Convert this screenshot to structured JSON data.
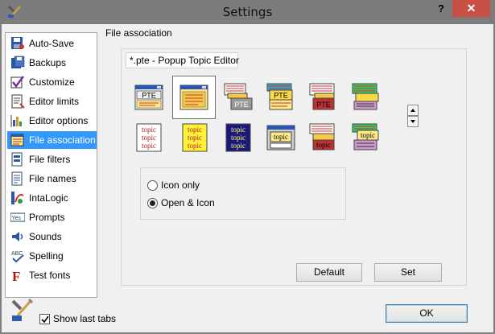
{
  "window": {
    "title": "Settings",
    "help_label": "?",
    "close_label": "✕"
  },
  "sidebar": {
    "items": [
      {
        "label": "Auto-Save",
        "icon": "auto-save-icon"
      },
      {
        "label": "Backups",
        "icon": "backups-icon"
      },
      {
        "label": "Customize",
        "icon": "customize-icon"
      },
      {
        "label": "Editor limits",
        "icon": "editor-limits-icon"
      },
      {
        "label": "Editor options",
        "icon": "editor-options-icon"
      },
      {
        "label": "File association",
        "icon": "file-association-icon",
        "selected": true
      },
      {
        "label": "File filters",
        "icon": "file-filters-icon"
      },
      {
        "label": "File names",
        "icon": "file-names-icon"
      },
      {
        "label": "IntaLogic",
        "icon": "intalogic-icon"
      },
      {
        "label": "Prompts",
        "icon": "prompts-icon"
      },
      {
        "label": "Sounds",
        "icon": "sounds-icon"
      },
      {
        "label": "Spelling",
        "icon": "spelling-icon"
      },
      {
        "label": "Test fonts",
        "icon": "test-fonts-icon"
      }
    ]
  },
  "panel": {
    "group_title": "File association",
    "association_text": "*.pte - Popup Topic Editor",
    "icon_labels": {
      "pte": "PTE",
      "topic": "topic"
    },
    "radio": {
      "icon_only": "Icon only",
      "open_and_icon": "Open & Icon",
      "selected": "open_and_icon"
    },
    "default_button": "Default",
    "set_button": "Set"
  },
  "footer": {
    "show_last_tabs": "Show last tabs",
    "show_last_tabs_checked": true,
    "ok_button": "OK"
  },
  "colors": {
    "selection": "#3399ff",
    "close": "#c74f43",
    "titlebar": "#7c7c7c"
  }
}
